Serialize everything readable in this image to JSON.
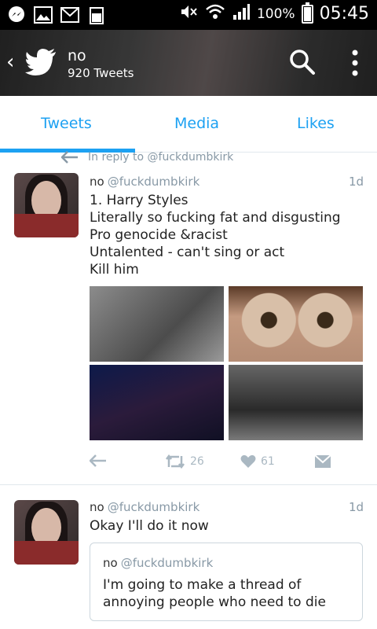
{
  "status_bar": {
    "battery_pct": "100%",
    "time": "05:45",
    "notif_icons": [
      "messenger-icon",
      "gallery-icon",
      "mail-icon",
      "battery-small-icon"
    ]
  },
  "header": {
    "back_label": "‹",
    "title": "no",
    "subtitle": "920 Tweets"
  },
  "tabs": [
    {
      "label": "Tweets",
      "active": true
    },
    {
      "label": "Media",
      "active": false
    },
    {
      "label": "Likes",
      "active": false
    }
  ],
  "accent_color": "#1da1f2",
  "tweets": [
    {
      "reply_to": "In reply to @fuckdumbkirk",
      "name": "no",
      "handle": "@fuckdumbkirk",
      "time": "1d",
      "lines": [
        "1. Harry Styles",
        "Literally so fucking fat and disgusting",
        "Pro genocide &racist",
        "Untalented - can't sing or act",
        "Kill him"
      ],
      "retweets": "26",
      "likes": "61"
    },
    {
      "name": "no",
      "handle": "@fuckdumbkirk",
      "time": "1d",
      "text": "Okay I'll do it now",
      "quote": {
        "name": "no",
        "handle": "@fuckdumbkirk",
        "lines": [
          "I'm going to make a thread of",
          "annoying people who need to die"
        ]
      }
    }
  ]
}
